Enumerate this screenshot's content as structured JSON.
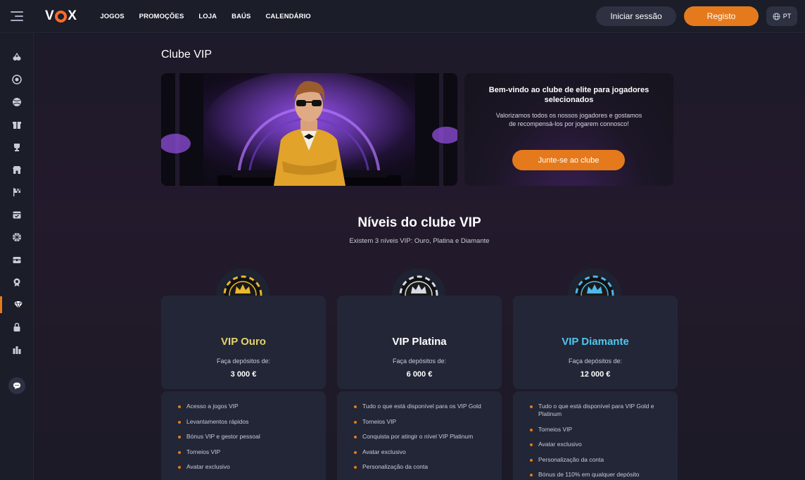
{
  "header": {
    "logo": "VOX",
    "nav": [
      "JOGOS",
      "PROMOÇÕES",
      "LOJA",
      "BAÚS",
      "CALENDÁRIO"
    ],
    "login_label": "Iniciar sessão",
    "register_label": "Registo",
    "language": "PT"
  },
  "sidebar": {
    "icons": [
      "fruit-icon",
      "roulette-icon",
      "sports-ball-icon",
      "gift-icon",
      "trophy-icon",
      "shop-icon",
      "flag-icon",
      "calendar-icon",
      "wheel-icon",
      "chest-icon",
      "medal-icon",
      "diamond-icon",
      "lock-icon",
      "chart-icon"
    ],
    "active": "diamond-icon",
    "chat_icon": "chat-icon"
  },
  "page": {
    "title": "Clube VIP",
    "welcome": {
      "title": "Bem-vindo ao clube de elite para jogadores selecionados",
      "text": "Valorizamos todos os nossos jogadores e gostamos de recompensá-los por jogarem connosco!",
      "button": "Junte-se ao clube"
    },
    "levels_title": "Níveis do clube VIP",
    "levels_subtitle": "Existem 3 níveis VIP: Ouro, Platina e Diamante"
  },
  "levels": [
    {
      "name": "VIP Ouro",
      "color": "#e3d26a",
      "badge_color": "#e8b830",
      "deposit_label": "Faça depósitos de:",
      "deposit_amount": "3 000 €",
      "benefits": [
        "Acesso a jogos VIP",
        "Levantamentos rápidos",
        "Bónus VIP e gestor pessoal",
        "Torneios VIP",
        "Avatar exclusivo"
      ]
    },
    {
      "name": "VIP Platina",
      "color": "#ffffff",
      "badge_color": "#d8dbe5",
      "deposit_label": "Faça depósitos de:",
      "deposit_amount": "6 000 €",
      "benefits": [
        "Tudo o que está disponível para os VIP Gold",
        "Torneios VIP",
        "Conquista por atingir o nível VIP Platinum",
        "Avatar exclusivo",
        "Personalização da conta"
      ]
    },
    {
      "name": "VIP Diamante",
      "color": "#4fc6f0",
      "badge_color": "#4fb8ea",
      "deposit_label": "Faça depósitos de:",
      "deposit_amount": "12 000 €",
      "benefits": [
        "Tudo o que está disponível para VIP Gold e Platinum",
        "Torneios VIP",
        "Avatar exclusivo",
        "Personalização da conta",
        "Bónus de 110% em qualquer depósito"
      ]
    }
  ]
}
